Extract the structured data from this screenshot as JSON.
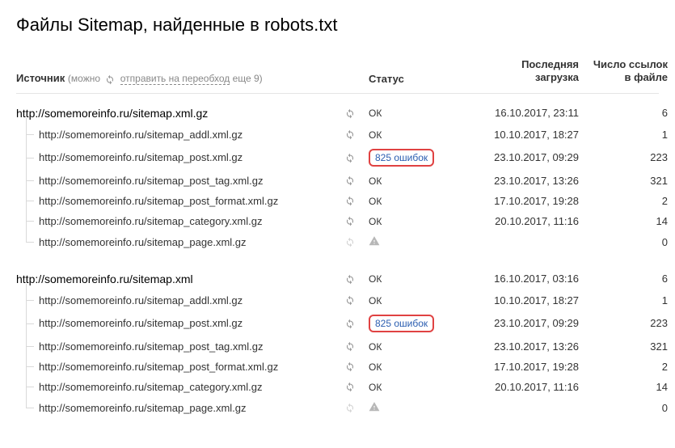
{
  "title": "Файлы Sitemap, найденные в robots.txt",
  "header": {
    "source_label": "Источник",
    "hint_prefix": "(можно",
    "hint_link": "отправить на переобход",
    "hint_suffix": "еще 9)",
    "status_label": "Статус",
    "date_label_l1": "Последняя",
    "date_label_l2": "загрузка",
    "count_label_l1": "Число ссылок",
    "count_label_l2": "в файле"
  },
  "status_text": {
    "ok": "ОК"
  },
  "sections": [
    {
      "parent": {
        "url": "http://somemoreinfo.ru/sitemap.xml.gz",
        "status": "ok",
        "date": "16.10.2017, 23:11",
        "count": "6"
      },
      "children": [
        {
          "url": "http://somemoreinfo.ru/sitemap_addl.xml.gz",
          "status": "ok",
          "date": "10.10.2017, 18:27",
          "count": "1"
        },
        {
          "url": "http://somemoreinfo.ru/sitemap_post.xml.gz",
          "status": "error",
          "status_text": "825 ошибок",
          "date": "23.10.2017, 09:29",
          "count": "223"
        },
        {
          "url": "http://somemoreinfo.ru/sitemap_post_tag.xml.gz",
          "status": "ok",
          "date": "23.10.2017, 13:26",
          "count": "321"
        },
        {
          "url": "http://somemoreinfo.ru/sitemap_post_format.xml.gz",
          "status": "ok",
          "date": "17.10.2017, 19:28",
          "count": "2"
        },
        {
          "url": "http://somemoreinfo.ru/sitemap_category.xml.gz",
          "status": "ok",
          "date": "20.10.2017, 11:16",
          "count": "14"
        },
        {
          "url": "http://somemoreinfo.ru/sitemap_page.xml.gz",
          "status": "warn",
          "date": "",
          "count": "0"
        }
      ]
    },
    {
      "parent": {
        "url": "http://somemoreinfo.ru/sitemap.xml",
        "status": "ok",
        "date": "16.10.2017, 03:16",
        "count": "6"
      },
      "children": [
        {
          "url": "http://somemoreinfo.ru/sitemap_addl.xml.gz",
          "status": "ok",
          "date": "10.10.2017, 18:27",
          "count": "1"
        },
        {
          "url": "http://somemoreinfo.ru/sitemap_post.xml.gz",
          "status": "error",
          "status_text": "825 ошибок",
          "date": "23.10.2017, 09:29",
          "count": "223"
        },
        {
          "url": "http://somemoreinfo.ru/sitemap_post_tag.xml.gz",
          "status": "ok",
          "date": "23.10.2017, 13:26",
          "count": "321"
        },
        {
          "url": "http://somemoreinfo.ru/sitemap_post_format.xml.gz",
          "status": "ok",
          "date": "17.10.2017, 19:28",
          "count": "2"
        },
        {
          "url": "http://somemoreinfo.ru/sitemap_category.xml.gz",
          "status": "ok",
          "date": "20.10.2017, 11:16",
          "count": "14"
        },
        {
          "url": "http://somemoreinfo.ru/sitemap_page.xml.gz",
          "status": "warn",
          "date": "",
          "count": "0"
        }
      ]
    }
  ]
}
